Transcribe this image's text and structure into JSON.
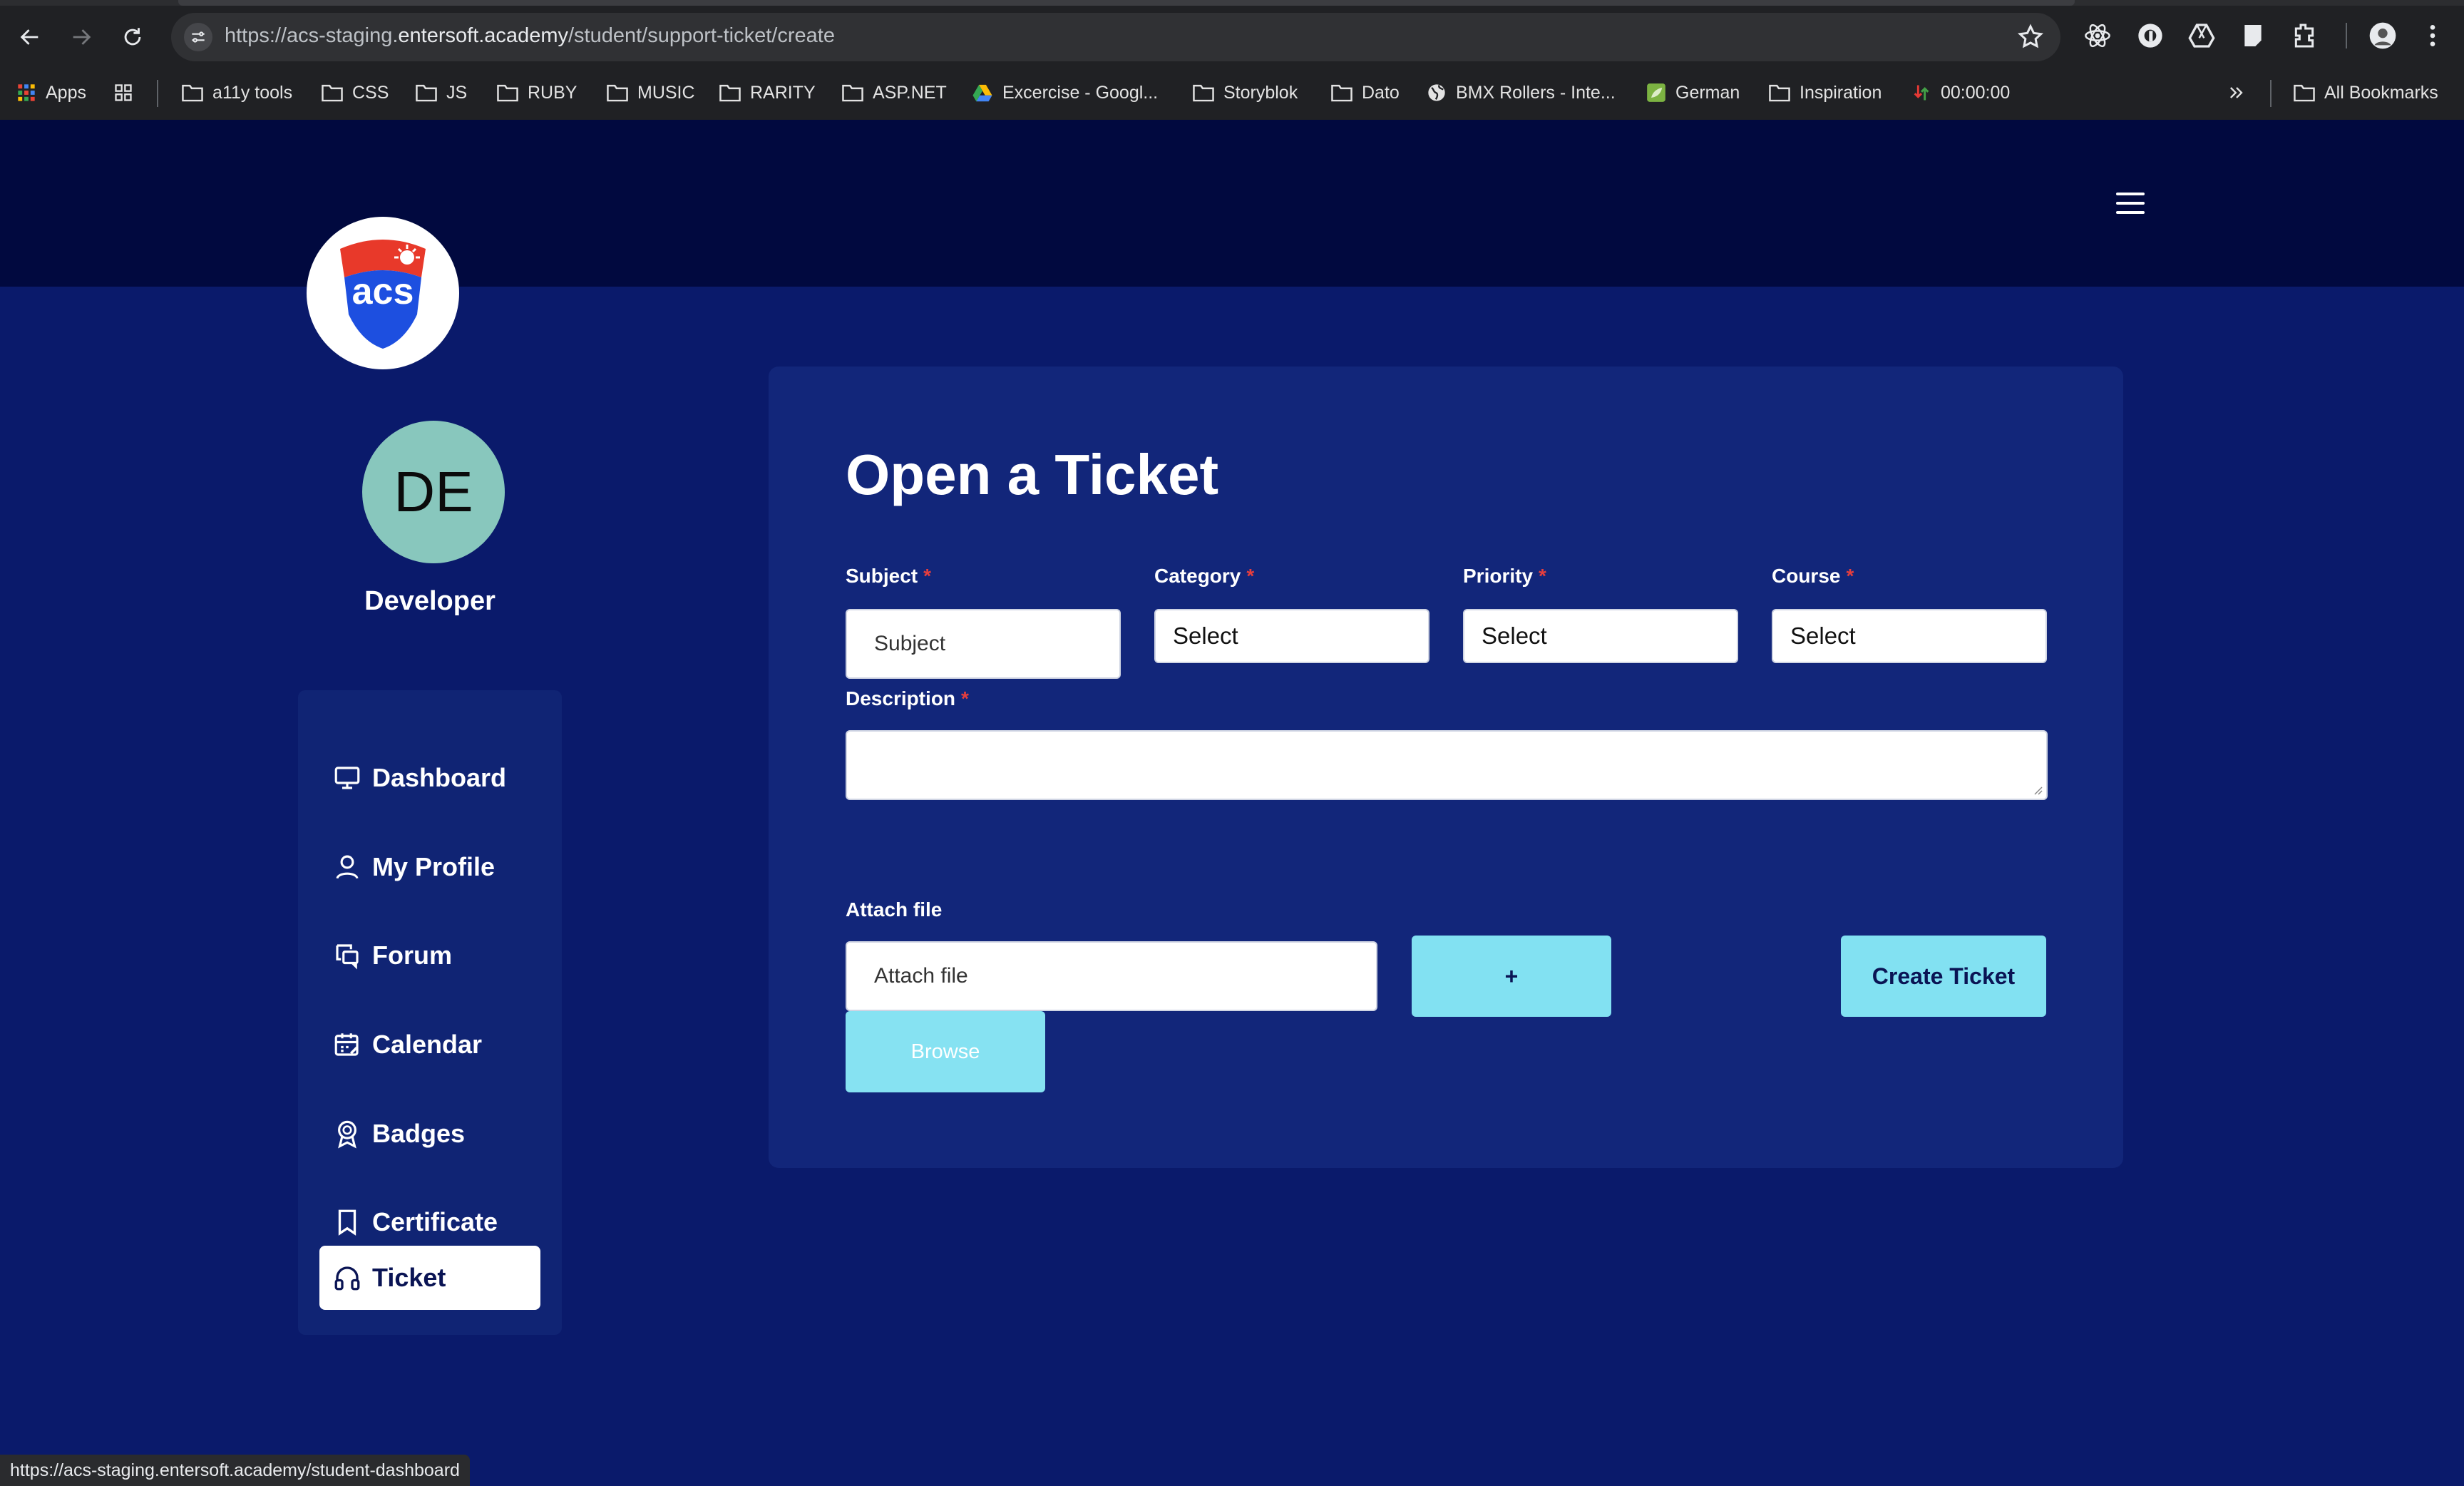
{
  "browser": {
    "url_prefix": "https://acs-staging.",
    "url_domain": "entersoft.academy",
    "url_path": "/student/support-ticket/create",
    "status_url": "https://acs-staging.entersoft.academy/student-dashboard"
  },
  "bookmarks": {
    "apps": "Apps",
    "items": [
      "a11y tools",
      "CSS",
      "JS",
      "RUBY",
      "MUSIC",
      "RARITY",
      "ASP.NET",
      "Excercise - Googl...",
      "Storyblok",
      "Dato",
      "BMX Rollers - Inte...",
      "German",
      "Inspiration",
      "00:00:00"
    ],
    "all_bookmarks": "All Bookmarks"
  },
  "logo": {
    "text": "acs"
  },
  "user": {
    "initials": "DE",
    "name": "Developer"
  },
  "sidebar": {
    "items": [
      {
        "label": "Dashboard",
        "icon": "monitor-icon"
      },
      {
        "label": "My Profile",
        "icon": "user-icon"
      },
      {
        "label": "Forum",
        "icon": "chat-icon"
      },
      {
        "label": "Calendar",
        "icon": "calendar-icon"
      },
      {
        "label": "Badges",
        "icon": "award-icon"
      },
      {
        "label": "Certificate",
        "icon": "bookmark-icon"
      },
      {
        "label": "Ticket",
        "icon": "headphones-icon",
        "active": true
      }
    ]
  },
  "form": {
    "title": "Open a Ticket",
    "subject_label": "Subject",
    "subject_placeholder": "Subject",
    "category_label": "Category",
    "category_value": "Select",
    "priority_label": "Priority",
    "priority_value": "Select",
    "course_label": "Course",
    "course_value": "Select",
    "description_label": "Description",
    "required_mark": "*",
    "attach_label": "Attach file",
    "attach_placeholder": "Attach file",
    "add_button": "+",
    "create_button": "Create Ticket",
    "browse_button": "Browse"
  },
  "colors": {
    "header_bg": "#01093f",
    "page_bg": "#0a1a6b",
    "card_bg": "#12267a",
    "accent_button": "#82e1f2",
    "required": "#e53e3e",
    "avatar_bg": "#88c7bd"
  }
}
